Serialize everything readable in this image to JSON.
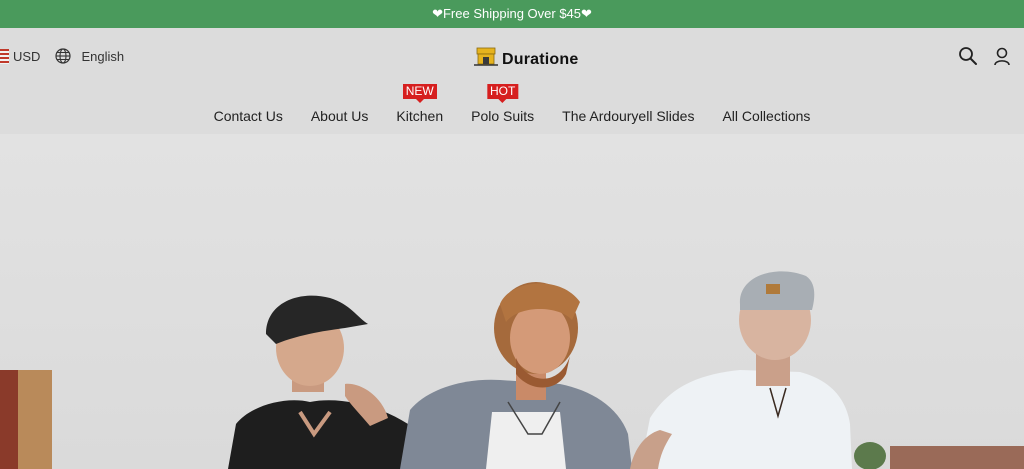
{
  "announcement": {
    "text": "❤Free Shipping Over $45❤"
  },
  "header": {
    "currency": "USD",
    "language": "English",
    "logo_text": "Duratione"
  },
  "nav": {
    "items": [
      {
        "label": "Contact Us",
        "badge": ""
      },
      {
        "label": "About Us",
        "badge": ""
      },
      {
        "label": "Kitchen",
        "badge": "NEW"
      },
      {
        "label": "Polo Suits",
        "badge": "HOT"
      },
      {
        "label": "The Ardouryell Slides",
        "badge": ""
      },
      {
        "label": "All Collections",
        "badge": ""
      }
    ]
  },
  "icons": {
    "currency_flag": "us-flag-icon",
    "language": "globe-icon",
    "search": "search-icon",
    "account": "user-icon",
    "logo": "store-icon"
  },
  "colors": {
    "announcement_bg": "#4a9a5c",
    "badge_bg": "#d61f1f",
    "page_bg": "#dcdcdc"
  }
}
